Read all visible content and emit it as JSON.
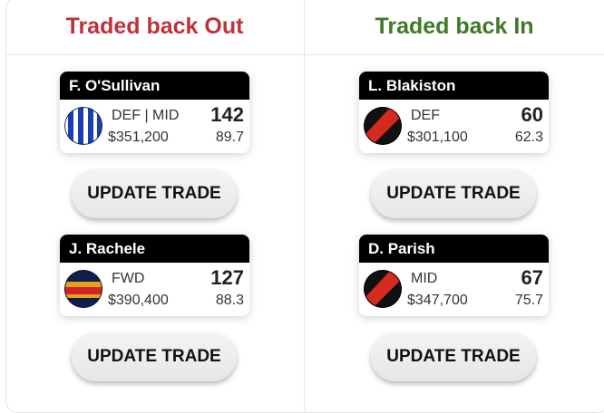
{
  "columns": {
    "out_title": "Traded back Out",
    "in_title": "Traded back In"
  },
  "cards": [
    {
      "name": "F. O'Sullivan",
      "position": "DEF | MID",
      "price": "$351,200",
      "score": "142",
      "average": "89.7",
      "team_icon": "blue-white-striped-guernsey-icon"
    },
    {
      "name": "L. Blakiston",
      "position": "DEF",
      "price": "$301,100",
      "score": "60",
      "average": "62.3",
      "team_icon": "black-red-sash-guernsey-icon"
    },
    {
      "name": "J. Rachele",
      "position": "FWD",
      "price": "$390,400",
      "score": "127",
      "average": "88.3",
      "team_icon": "navy-red-gold-hooped-guernsey-icon"
    },
    {
      "name": "D. Parish",
      "position": "MID",
      "price": "$347,700",
      "score": "67",
      "average": "75.7",
      "team_icon": "black-red-sash-guernsey-icon"
    }
  ],
  "buttons": {
    "update_trade_label": "UPDATE TRADE"
  },
  "colors": {
    "out_title": "#c0303a",
    "in_title": "#3e7a25"
  }
}
